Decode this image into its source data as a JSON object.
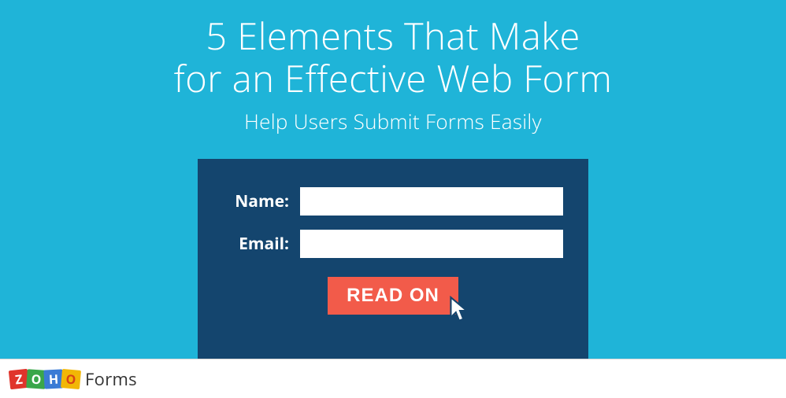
{
  "headline_line1": "5 Elements That Make",
  "headline_line2": "for an Effective Web Form",
  "subheadline": "Help Users Submit Forms Easily",
  "form": {
    "name_label": "Name:",
    "email_label": "Email:",
    "name_value": "",
    "email_value": ""
  },
  "cta_button": "READ ON",
  "logo": {
    "z": "Z",
    "o1": "O",
    "h": "H",
    "o2": "O",
    "product": "Forms"
  }
}
